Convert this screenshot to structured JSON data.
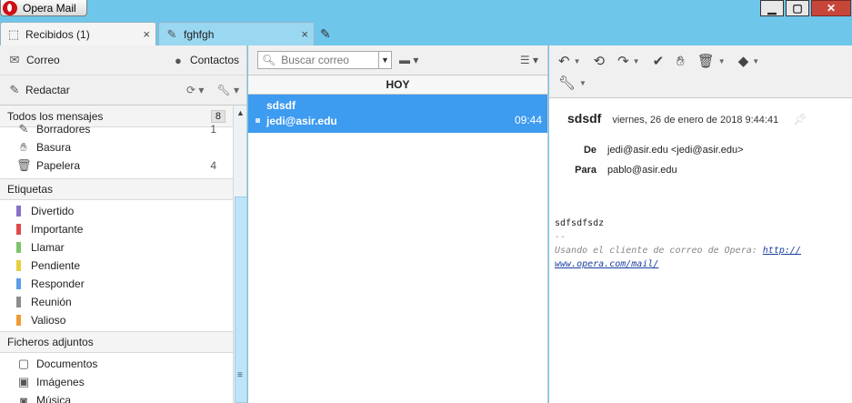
{
  "window": {
    "app_title": "Opera Mail",
    "controls": {
      "minimize": "▁",
      "maximize": "▢",
      "close": "✕"
    }
  },
  "tabs": [
    {
      "label": "Recibidos (1)",
      "icon": "inbox-icon"
    },
    {
      "label": "fghfgh",
      "icon": "pencil-icon"
    }
  ],
  "sidebar": {
    "mail_label": "Correo",
    "contacts_label": "Contactos",
    "compose_label": "Redactar",
    "all_messages": {
      "label": "Todos los mensajes",
      "count": "8"
    },
    "folders": [
      {
        "label": "Borradores",
        "count": "1"
      },
      {
        "label": "Basura",
        "count": ""
      },
      {
        "label": "Papelera",
        "count": "4"
      }
    ],
    "labels_header": "Etiquetas",
    "labels": [
      {
        "label": "Divertido",
        "color": "#8a6fc9"
      },
      {
        "label": "Importante",
        "color": "#e04a4a"
      },
      {
        "label": "Llamar",
        "color": "#7cc46a"
      },
      {
        "label": "Pendiente",
        "color": "#e6cf3a"
      },
      {
        "label": "Responder",
        "color": "#5b9ee8"
      },
      {
        "label": "Reunión",
        "color": "#8c8c8c"
      },
      {
        "label": "Valioso",
        "color": "#f09a34"
      }
    ],
    "attachments_header": "Ficheros adjuntos",
    "attachments": [
      {
        "label": "Documentos"
      },
      {
        "label": "Imágenes"
      },
      {
        "label": "Música"
      }
    ]
  },
  "list": {
    "search_placeholder": "Buscar correo",
    "group_header": "HOY",
    "messages": [
      {
        "subject": "sdsdf",
        "from": "jedi@asir.edu",
        "time": "09:44"
      }
    ]
  },
  "reader": {
    "subject": "sdsdf",
    "date": "viernes, 26 de enero de 2018 9:44:41",
    "from_label": "De",
    "from": "jedi@asir.edu <jedi@asir.edu>",
    "to_label": "Para",
    "to": "pablo@asir.edu",
    "body_line": "sdfsdfsdz",
    "sig_sep": "--",
    "sig_text": "Usando el cliente de correo de Opera: ",
    "sig_link_1": "http://",
    "sig_link_2": "www.opera.com/mail/"
  }
}
